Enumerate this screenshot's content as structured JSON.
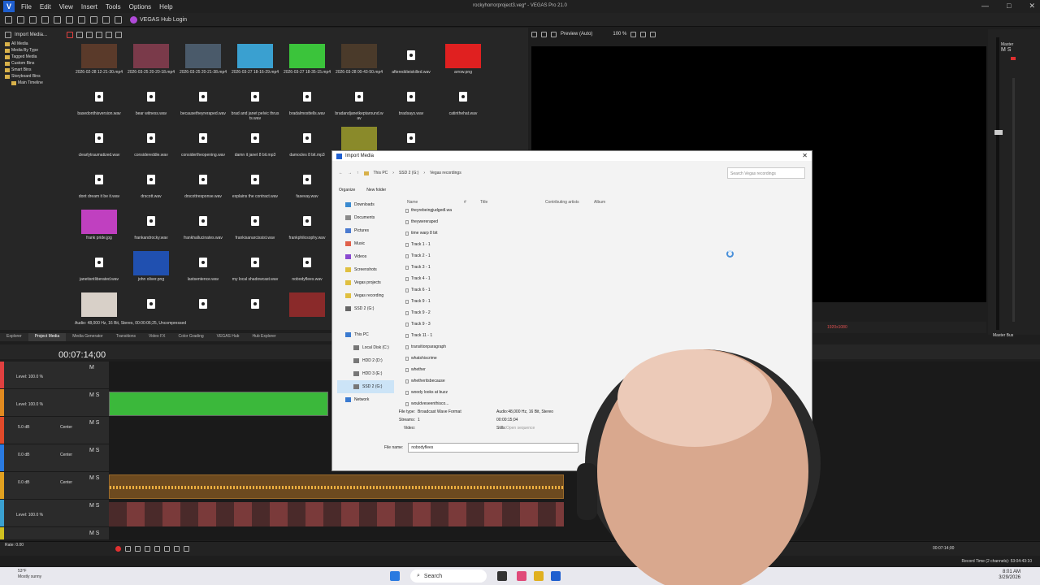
{
  "app": {
    "title": "rockyhorrorproject3.veg* - VEGAS Pro 21.0",
    "menu": [
      "File",
      "Edit",
      "View",
      "Insert",
      "Tools",
      "Options",
      "Help"
    ],
    "hub_login": "VEGAS Hub Login",
    "window_buttons": [
      "—",
      "□",
      "✕"
    ]
  },
  "media": {
    "toolbar_label": "Import Media...",
    "tree": [
      "All Media",
      "Media By Type",
      "Tagged Media",
      "Custom Bins",
      "Smart Bins",
      "Storyboard Bins",
      "Main Timeline"
    ],
    "tiles": [
      {
        "name": "2026-02-28 12-21-30.mp4",
        "kind": "video",
        "color": "#5a3a2a"
      },
      {
        "name": "2026-03-25 20-20-18.mp4",
        "kind": "video",
        "color": "#7a3a4a"
      },
      {
        "name": "2026-03-25 20-21-38.mp4",
        "kind": "video",
        "color": "#4a5a6a"
      },
      {
        "name": "2026-03-27 18-16-29.mp4",
        "kind": "video",
        "color": "#3aa0d0"
      },
      {
        "name": "2026-03-27 18-35-15.mp4",
        "kind": "video",
        "color": "#3bc43b"
      },
      {
        "name": "2026-03-28 00-43-50.mp4",
        "kind": "video",
        "color": "#4a3a2a"
      },
      {
        "name": "aftereddieiskilled.wav",
        "kind": "audio"
      },
      {
        "name": "arrow.png",
        "kind": "image",
        "color": "#e02020"
      },
      {
        "name": "basedonthisversion.wav",
        "kind": "audio"
      },
      {
        "name": "bear witness.wav",
        "kind": "audio"
      },
      {
        "name": "becausetheyreraped.wav",
        "kind": "audio"
      },
      {
        "name": "brad and janet pelvic thrusts.wav",
        "kind": "audio"
      },
      {
        "name": "bradalmosttells.wav",
        "kind": "audio"
      },
      {
        "name": "bradandjanetkeptaround.wav",
        "kind": "audio"
      },
      {
        "name": "bradsays.wav",
        "kind": "audio"
      },
      {
        "name": "catinthehat.wav",
        "kind": "audio"
      },
      {
        "name": "clearlytraumatized.wav",
        "kind": "audio"
      },
      {
        "name": "considereddie.wav",
        "kind": "audio"
      },
      {
        "name": "considertheopening.wav",
        "kind": "audio"
      },
      {
        "name": "damn it janet 8 bit.mp3",
        "kind": "audio"
      },
      {
        "name": "damocles 8 bit.mp3",
        "kind": "audio"
      },
      {
        "name": "",
        "kind": "video",
        "color": "#8a8a2a"
      },
      {
        "name": "",
        "kind": "audio"
      },
      {
        "name": "",
        "kind": "blank"
      },
      {
        "name": "dont dream it be it.wav",
        "kind": "audio"
      },
      {
        "name": "drscott.wav",
        "kind": "audio"
      },
      {
        "name": "drscottresponse.wav",
        "kind": "audio"
      },
      {
        "name": "explains the contract.wav",
        "kind": "audio"
      },
      {
        "name": "fasevay.wav",
        "kind": "audio"
      },
      {
        "name": "",
        "kind": "blank"
      },
      {
        "name": "",
        "kind": "blank"
      },
      {
        "name": "",
        "kind": "blank"
      },
      {
        "name": "frank pride.jpg",
        "kind": "image",
        "color": "#c040c0"
      },
      {
        "name": "frankandrocky.wav",
        "kind": "audio"
      },
      {
        "name": "frankhallucinates.wav",
        "kind": "audio"
      },
      {
        "name": "frankisanarcissist.wav",
        "kind": "audio"
      },
      {
        "name": "frankphilosophy.wav",
        "kind": "audio"
      },
      {
        "name": "",
        "kind": "blank"
      },
      {
        "name": "",
        "kind": "blank"
      },
      {
        "name": "",
        "kind": "blank"
      },
      {
        "name": "janetisntliberated.wav",
        "kind": "audio"
      },
      {
        "name": "john oliver.png",
        "kind": "image",
        "color": "#2050b0"
      },
      {
        "name": "lastsentence.wav",
        "kind": "audio"
      },
      {
        "name": "my local shadowcast.wav",
        "kind": "audio"
      },
      {
        "name": "nobodyflees.wav",
        "kind": "audio"
      },
      {
        "name": "",
        "kind": "blank"
      },
      {
        "name": "",
        "kind": "blank"
      },
      {
        "name": "",
        "kind": "blank"
      },
      {
        "name": "",
        "kind": "image",
        "color": "#d8d0c8"
      },
      {
        "name": "",
        "kind": "audio"
      },
      {
        "name": "",
        "kind": "audio"
      },
      {
        "name": "",
        "kind": "audio"
      },
      {
        "name": "",
        "kind": "image",
        "color": "#8a2a2a"
      },
      {
        "name": "",
        "kind": "image",
        "color": "#6a2a2a"
      }
    ],
    "status": "Audio: 48,000 Hz, 16 Bit, Stereo, 00:00:06;25, Uncompressed",
    "tabs": [
      "Explorer",
      "Project Media",
      "Media Generator",
      "Transitions",
      "Video FX",
      "Color Grading",
      "VEGAS Hub",
      "Hub Explorer"
    ]
  },
  "preview": {
    "mode": "Preview (Auto)",
    "zoom": "100 %",
    "resolution": "1920x1080"
  },
  "master": {
    "label": "Master",
    "ms": "M  S",
    "bus_label": "Master Bus"
  },
  "timeline": {
    "timecode": "00:07:14;00",
    "tracks": [
      {
        "level": "Level: 100.0 %",
        "color": "#e04040",
        "ms": "M"
      },
      {
        "level": "Level: 100.0 %",
        "color": "#e08a20",
        "ms": "M  S"
      },
      {
        "db": "5.0 dB",
        "pan": "Center",
        "color": "#e04a2a",
        "ms": "M  S"
      },
      {
        "db": "0.0 dB",
        "pan": "Center",
        "color": "#2a7ae0",
        "ms": "M  S"
      },
      {
        "db": "0.0 dB",
        "pan": "Center",
        "color": "#e0a020",
        "ms": "M  S"
      },
      {
        "level": "Level: 100.0 %",
        "color": "#3aa0d0",
        "ms": "M  S"
      },
      {
        "level": "",
        "color": "#d0c020",
        "ms": "M  S"
      }
    ],
    "rate": "Rate: 0.00",
    "end_time": "00:07:14;00",
    "record_time": "Record Time (2 channels): 53:04:43:10"
  },
  "dialog": {
    "title": "Import Media",
    "path": [
      "This PC",
      "SSD 2 (G:)",
      "Vegas recordings"
    ],
    "search_placeholder": "Search Vegas recordings",
    "organize": "Organize",
    "new_folder": "New folder",
    "nav": [
      {
        "label": "Downloads",
        "color": "#3a8ad0"
      },
      {
        "label": "Documents",
        "color": "#8a8a8a"
      },
      {
        "label": "Pictures",
        "color": "#4a7ad0"
      },
      {
        "label": "Music",
        "color": "#e0604a"
      },
      {
        "label": "Videos",
        "color": "#8a4ad0"
      },
      {
        "label": "Screenshots",
        "color": "#e0c040"
      },
      {
        "label": "Vegas projects",
        "color": "#e0c040"
      },
      {
        "label": "Vegas recording",
        "color": "#e0c040"
      },
      {
        "label": "SSD 2 (G:)",
        "color": "#666666"
      },
      {
        "label": "",
        "color": "transparent"
      },
      {
        "label": "This PC",
        "color": "#3a7ad0"
      },
      {
        "label": "Local Disk (C:)",
        "color": "#777777"
      },
      {
        "label": "HDD 2 (D:)",
        "color": "#777777"
      },
      {
        "label": "HDD 3 (E:)",
        "color": "#777777"
      },
      {
        "label": "SSD 2 (G:)",
        "color": "#777777"
      },
      {
        "label": "Network",
        "color": "#3a7ad0"
      }
    ],
    "columns": [
      "Name",
      "#",
      "Title",
      "Contributing artists",
      "Album"
    ],
    "files": [
      "theyrebeingjudgedl.wa",
      "theywereraped",
      "time warp 8 bit",
      "Track 1 - 1",
      "Track 2 - 1",
      "Track 3 - 1",
      "Track 4 - 1",
      "Track 6 - 1",
      "Track 9 - 1",
      "Track 9 - 2",
      "Track 9 - 3",
      "Track 11 - 1",
      "transitionparagraph",
      "whatshiscrime",
      "whether",
      "whetheritsbecause",
      "woody looks at buzz",
      "wouldveseenthisco..."
    ],
    "props": {
      "file_type_k": "File type:",
      "file_type": "Broadcast Wave Format",
      "streams_k": "Streams:",
      "streams": "1",
      "video_k": "Video:",
      "video": "",
      "audio_k": "Audio:",
      "audio": "48,000 Hz, 16 Bit, Stereo",
      "duration": "00:00:15;04",
      "stills_k": "Stills:",
      "stills": "Open sequence"
    },
    "filename_label": "File name:",
    "filename": "nobodyflees"
  },
  "taskbar": {
    "temp": "53°F",
    "weather": "Mostly sunny",
    "search": "Search",
    "time": "8:01 AM",
    "date": "3/29/2026"
  }
}
